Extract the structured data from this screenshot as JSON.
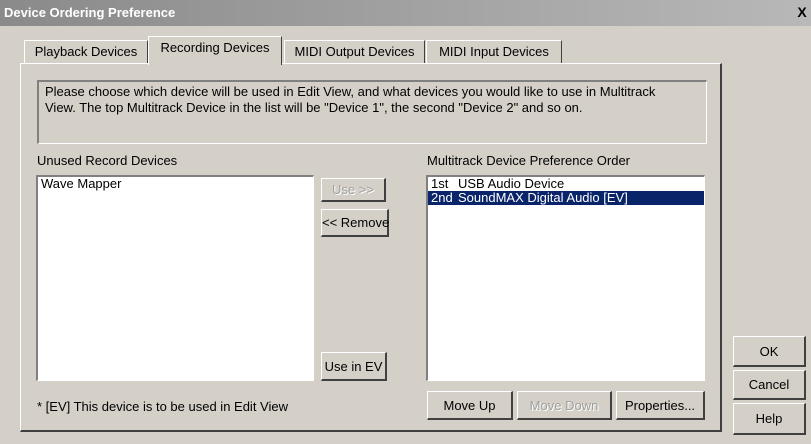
{
  "window": {
    "title": "Device Ordering Preference",
    "close_label": "X"
  },
  "tabs": [
    {
      "label": "Playback Devices",
      "active": false
    },
    {
      "label": "Recording Devices",
      "active": true
    },
    {
      "label": "MIDI Output Devices",
      "active": false
    },
    {
      "label": "MIDI Input Devices",
      "active": false
    }
  ],
  "info": {
    "line1": "Please choose which device will be used in Edit View, and what devices you would like to use in Multitrack",
    "line2": "View.  The top Multitrack Device in the list will be \"Device 1\", the second \"Device 2\" and so on."
  },
  "unused": {
    "label": "Unused Record Devices",
    "items": [
      "Wave Mapper"
    ]
  },
  "multitrack": {
    "label": "Multitrack Device Preference Order",
    "items": [
      {
        "order": "1st",
        "name": "USB Audio Device",
        "selected": false
      },
      {
        "order": "2nd",
        "name": "SoundMAX Digital Audio [EV]",
        "selected": true
      }
    ]
  },
  "buttons": {
    "use": "Use >>",
    "remove": "<< Remove",
    "use_in_ev": "Use in EV",
    "move_up": "Move Up",
    "move_down": "Move Down",
    "properties": "Properties...",
    "ok": "OK",
    "cancel": "Cancel",
    "help": "Help"
  },
  "footnote": "* [EV] This device is to be used in Edit View",
  "colors": {
    "selection": "#0a246a",
    "face": "#d4d0c8"
  }
}
